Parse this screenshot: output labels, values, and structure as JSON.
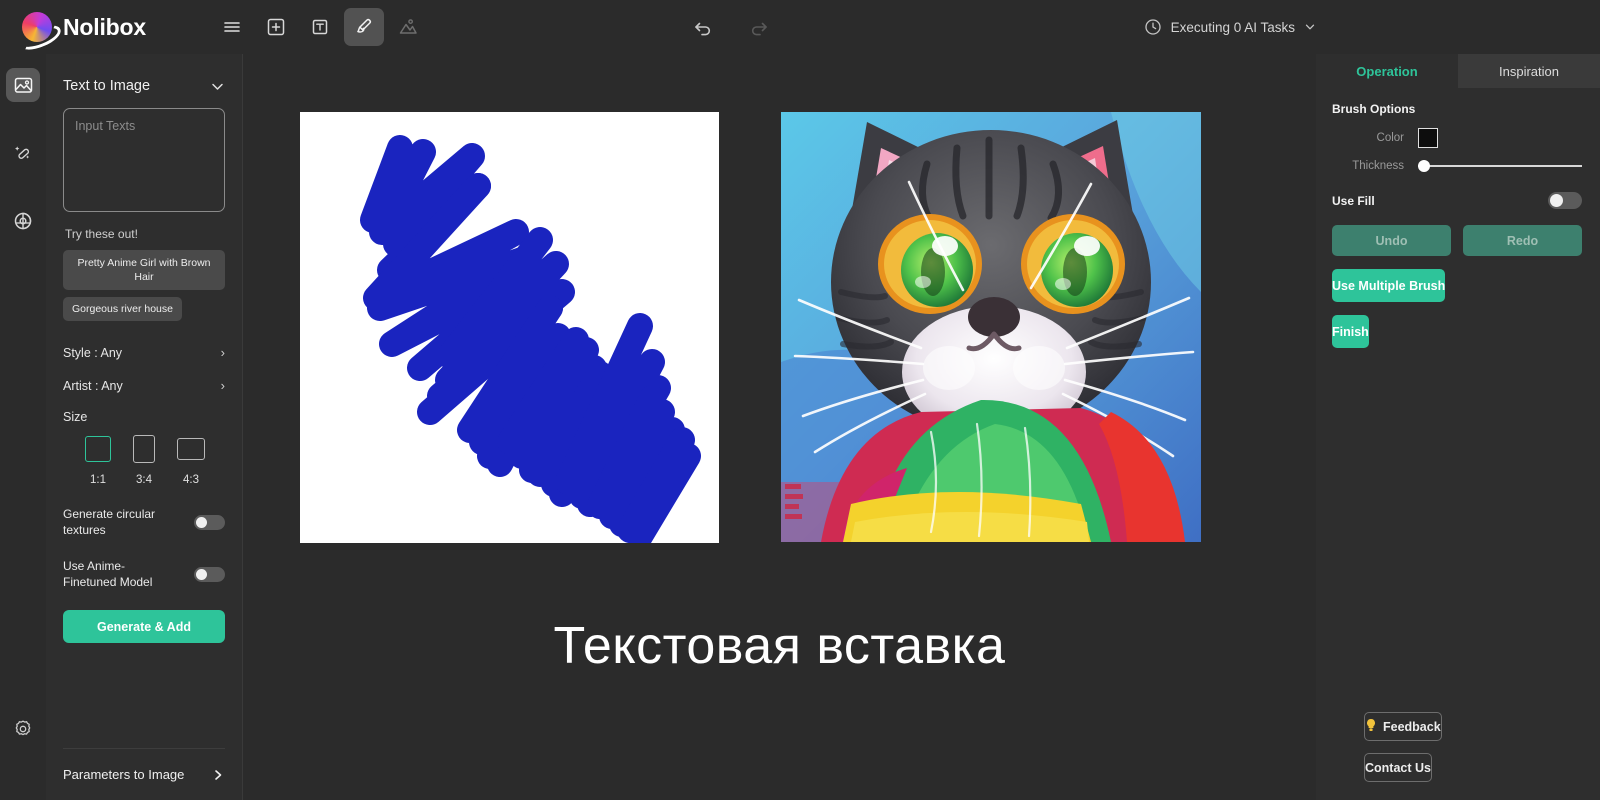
{
  "app": {
    "brand": "Nolibox",
    "logo_colors": [
      "#f7b733",
      "#ee3d66",
      "#c33bd9",
      "#6f4df0"
    ],
    "accent": "#2ec49a"
  },
  "toolbar": {
    "items": [
      {
        "name": "menu-icon",
        "label": "Menu"
      },
      {
        "name": "add-icon",
        "label": "Add"
      },
      {
        "name": "text-icon",
        "label": "Text"
      },
      {
        "name": "brush-icon",
        "label": "Brush"
      },
      {
        "name": "image-icon",
        "label": "Image"
      }
    ],
    "undo_label": "Undo",
    "redo_label": "Redo",
    "tasks_label": "Executing 0 AI Tasks"
  },
  "rail": {
    "items": [
      {
        "name": "sidebar-item-image",
        "label": "Image"
      },
      {
        "name": "sidebar-item-magic-wand",
        "label": "Magic"
      },
      {
        "name": "sidebar-item-target",
        "label": "Target"
      }
    ],
    "settings_label": "Settings"
  },
  "left_panel": {
    "title": "Text to Image",
    "prompt_placeholder": "Input Texts",
    "prompt_value": "",
    "try_label": "Try these out!",
    "suggestions": [
      "Pretty Anime Girl with Brown Hair",
      "Gorgeous river house"
    ],
    "rows": [
      {
        "label": "Style : Any"
      },
      {
        "label": "Artist : Any"
      }
    ],
    "size_label": "Size",
    "sizes": [
      {
        "ratio": "1:1",
        "selected": true
      },
      {
        "ratio": "3:4",
        "selected": false
      },
      {
        "ratio": "4:3",
        "selected": false
      }
    ],
    "toggles": [
      {
        "label": "Generate circular textures",
        "on": false
      },
      {
        "label": "Use Anime-Finetuned Model",
        "on": false
      }
    ],
    "generate_label": "Generate & Add",
    "footer_label": "Parameters to Image"
  },
  "canvas": {
    "text_element": "Текстовая вставка",
    "scribble_color": "#1a24bf",
    "scribble_bg": "#ffffff"
  },
  "right_panel": {
    "tabs": [
      {
        "label": "Operation",
        "active": true
      },
      {
        "label": "Inspiration",
        "active": false
      }
    ],
    "section_title": "Brush Options",
    "color_label": "Color",
    "color_value": "#0d0d0d",
    "thickness_label": "Thickness",
    "thickness_percent": 0,
    "use_fill_label": "Use Fill",
    "use_fill_on": false,
    "undo_label": "Undo",
    "redo_label": "Redo",
    "multiple_brush_label": "Use Multiple Brush",
    "finish_label": "Finish",
    "feedback_label": "Feedback",
    "contact_label": "Contact Us"
  }
}
